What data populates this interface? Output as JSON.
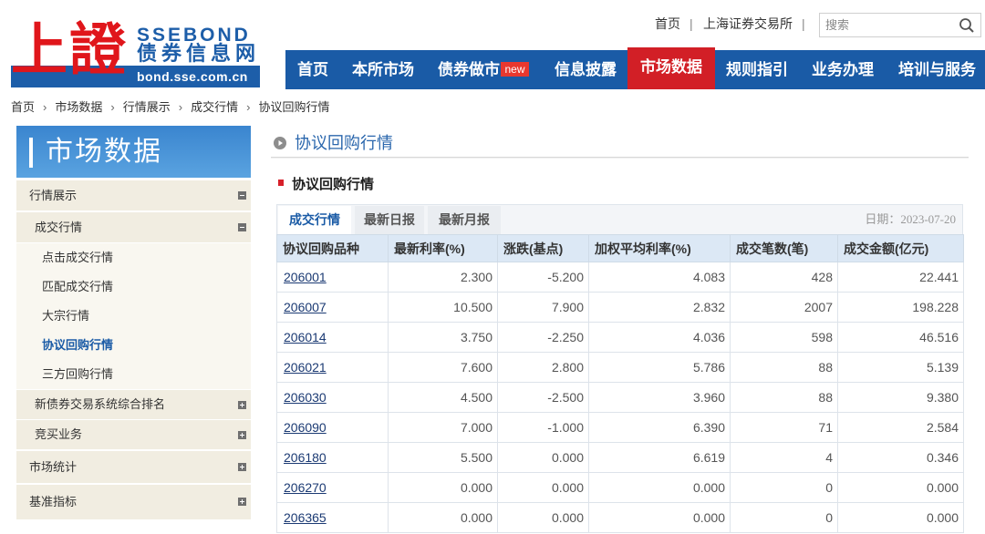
{
  "header": {
    "logo": {
      "chinese": "上證",
      "brand": "SSEBOND",
      "site_name": "债券信息网",
      "domain": "bond.sse.com.cn"
    },
    "top_links": {
      "separator": "|",
      "items": [
        {
          "label": "首页"
        },
        {
          "label": "上海证券交易所"
        }
      ]
    },
    "search": {
      "placeholder": "搜索",
      "value": "",
      "icon": "search-icon"
    },
    "nav": {
      "items": [
        {
          "label": "首页"
        },
        {
          "label": "本所市场"
        },
        {
          "label": "债券做市",
          "badge": "new"
        },
        {
          "label": "信息披露"
        },
        {
          "label": "市场数据",
          "active": true
        },
        {
          "label": "规则指引"
        },
        {
          "label": "业务办理"
        },
        {
          "label": "培训与服务"
        }
      ]
    }
  },
  "breadcrumb": {
    "separator": "›",
    "items": [
      "首页",
      "市场数据",
      "行情展示",
      "成交行情",
      "协议回购行情"
    ]
  },
  "sidebar": {
    "title": "市场数据",
    "menu": [
      {
        "label": "行情展示",
        "icon": "collapse-icon",
        "expanded": true,
        "children": [
          {
            "label": "成交行情",
            "icon": "collapse-icon",
            "expanded": true,
            "children": [
              {
                "label": "点击成交行情"
              },
              {
                "label": "匹配成交行情"
              },
              {
                "label": "大宗行情"
              },
              {
                "label": "协议回购行情",
                "active": true
              },
              {
                "label": "三方回购行情"
              }
            ]
          },
          {
            "label": "新债券交易系统综合排名",
            "icon": "expand-icon",
            "expanded": false
          },
          {
            "label": "竞买业务",
            "icon": "expand-icon",
            "expanded": false
          }
        ]
      },
      {
        "label": "市场统计",
        "icon": "expand-icon",
        "expanded": false
      },
      {
        "label": "基准指标",
        "icon": "expand-icon",
        "expanded": false
      }
    ]
  },
  "main": {
    "page_title": "协议回购行情",
    "section_title": "协议回购行情",
    "tabs": [
      {
        "label": "成交行情",
        "active": true
      },
      {
        "label": "最新日报"
      },
      {
        "label": "最新月报"
      }
    ],
    "date_label": "日期：",
    "date": "2023-07-20",
    "table": {
      "columns": [
        "协议回购品种",
        "最新利率(%)",
        "涨跌(基点)",
        "加权平均利率(%)",
        "成交笔数(笔)",
        "成交金额(亿元)"
      ],
      "rows": [
        [
          "206001",
          "2.300",
          "-5.200",
          "4.083",
          "428",
          "22.441"
        ],
        [
          "206007",
          "10.500",
          "7.900",
          "2.832",
          "2007",
          "198.228"
        ],
        [
          "206014",
          "3.750",
          "-2.250",
          "4.036",
          "598",
          "46.516"
        ],
        [
          "206021",
          "7.600",
          "2.800",
          "5.786",
          "88",
          "5.139"
        ],
        [
          "206030",
          "4.500",
          "-2.500",
          "3.960",
          "88",
          "9.380"
        ],
        [
          "206090",
          "7.000",
          "-1.000",
          "6.390",
          "71",
          "2.584"
        ],
        [
          "206180",
          "5.500",
          "0.000",
          "6.619",
          "4",
          "0.346"
        ],
        [
          "206270",
          "0.000",
          "0.000",
          "0.000",
          "0",
          "0.000"
        ],
        [
          "206365",
          "0.000",
          "0.000",
          "0.000",
          "0",
          "0.000"
        ]
      ]
    }
  },
  "colors": {
    "nav_bg": "#1a5ba6",
    "nav_active_bg": "#d21f26",
    "logo_red": "#e0161b",
    "logo_blue": "#1d5ea9",
    "table_header_bg": "#dce8f5",
    "link": "#1b3a73"
  }
}
